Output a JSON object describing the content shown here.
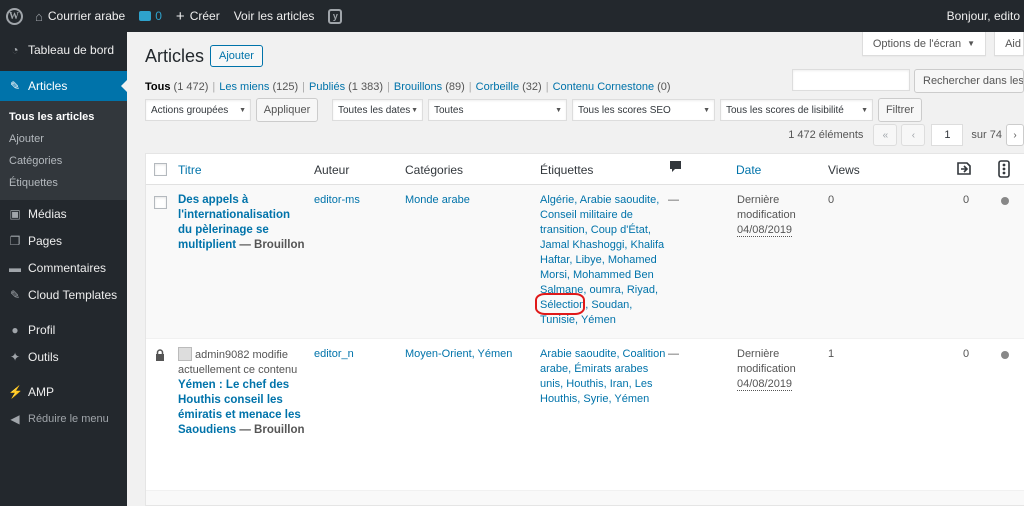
{
  "adminbar": {
    "site_name": "Courrier arabe",
    "comments_count": "0",
    "new_label": "Créer",
    "view_posts": "Voir les articles",
    "greeting": "Bonjour, edito"
  },
  "menu": {
    "dashboard": "Tableau de bord",
    "articles": "Articles",
    "sub": [
      "Tous les articles",
      "Ajouter",
      "Catégories",
      "Étiquettes"
    ],
    "media": "Médias",
    "pages": "Pages",
    "comments": "Commentaires",
    "cloud": "Cloud Templates",
    "profile": "Profil",
    "tools": "Outils",
    "amp": "AMP",
    "collapse": "Réduire le menu"
  },
  "screen_options": "Options de l'écran",
  "help": "Aid",
  "page_title": "Articles",
  "add_new": "Ajouter",
  "views": [
    {
      "label": "Tous",
      "count": "(1 472)"
    },
    {
      "label": "Les miens",
      "count": "(125)"
    },
    {
      "label": "Publiés",
      "count": "(1 383)"
    },
    {
      "label": "Brouillons",
      "count": "(89)"
    },
    {
      "label": "Corbeille",
      "count": "(32)"
    },
    {
      "label": "Contenu Cornestone",
      "count": "(0)"
    }
  ],
  "search_button": "Rechercher dans les ar",
  "filters": {
    "bulk": "Actions groupées",
    "apply": "Appliquer",
    "dates": "Toutes les dates",
    "categories": "Toutes",
    "seo": "Tous les scores SEO",
    "readability": "Tous les scores de lisibilité",
    "filter": "Filtrer"
  },
  "pagination": {
    "items": "1 472 éléments",
    "first": "«",
    "prev": "‹",
    "current": "1",
    "of": "sur 74",
    "next": "›"
  },
  "columns": {
    "title": "Titre",
    "author": "Auteur",
    "categories": "Catégories",
    "tags": "Étiquettes",
    "date": "Date",
    "views": "Views"
  },
  "rows": [
    {
      "title_lines": [
        "Des appels à",
        "l'internationalisation",
        "du pèlerinage se"
      ],
      "title_last": "multiplient",
      "state": " — Brouillon",
      "author": "editor-ms",
      "category": "Monde arabe",
      "tags_lines": [
        "Algérie, Arabie saoudite,",
        "Conseil militaire de",
        "transition, Coup d'État,",
        "Jamal Khashoggi, Khalifa",
        "Haftar, Libye, Mohamed",
        "Morsi, Mohammed Ben",
        "Salmane, oumra, Riyad,"
      ],
      "tag_highlight": "Sélection",
      "tag_after": ", Soudan,",
      "tags_end": "Tunisie, Yémen",
      "comments": "—",
      "date_status": "Dernière",
      "date_status2": "modification",
      "date": "04/08/2019",
      "views": "0",
      "seo": "0"
    },
    {
      "lock_user": "admin9082 modifie",
      "lock_note": "actuellement ce contenu",
      "title_lines": [
        "Yémen : Le chef des",
        "Houthis conseil les",
        "émiratis et menace les"
      ],
      "title_last": "Saoudiens",
      "state": " — Brouillon",
      "author": "editor_n",
      "category": "Moyen-Orient, Yémen",
      "tags_lines": [
        "Arabie saoudite, Coalition",
        "arabe, Émirats arabes",
        "unis, Houthis, Iran, Les",
        "Houthis, Syrie, Yémen"
      ],
      "comments": "—",
      "date_status": "Dernière",
      "date_status2": "modification",
      "date": "04/08/2019",
      "views": "1",
      "seo": "0"
    }
  ],
  "colors": {
    "accent": "#0073aa",
    "adminbar": "#23282d",
    "highlight_circle": "#e01919"
  }
}
